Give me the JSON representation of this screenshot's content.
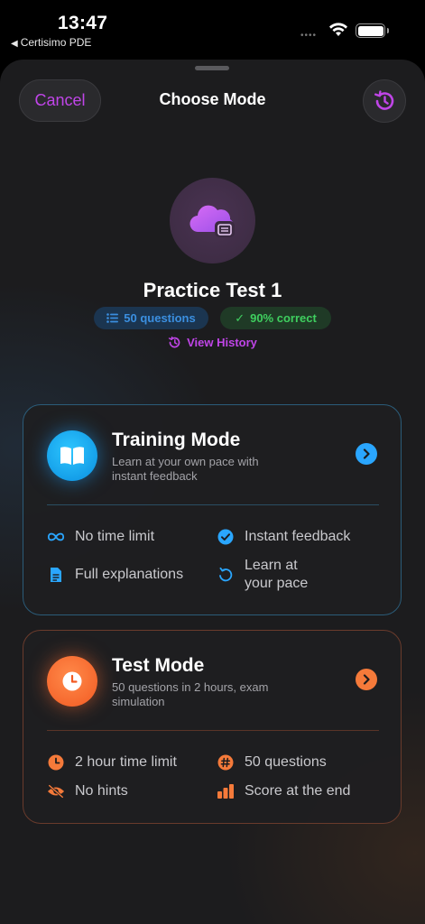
{
  "status_bar": {
    "time": "13:47",
    "back_app": "Certisimo PDE",
    "signal": "••••"
  },
  "header": {
    "cancel_label": "Cancel",
    "title": "Choose Mode"
  },
  "practice": {
    "title": "Practice Test 1",
    "questions_badge": "50 questions",
    "correct_badge": "90% correct",
    "view_history_label": "View History"
  },
  "training_mode": {
    "title": "Training Mode",
    "subtitle": "Learn at your own pace with instant feedback",
    "features": [
      {
        "icon": "infinity-icon",
        "label": "No time limit"
      },
      {
        "icon": "checkmark-circle-icon",
        "label": "Instant feedback"
      },
      {
        "icon": "document-icon",
        "label": "Full explanations"
      },
      {
        "icon": "refresh-icon",
        "label": "Learn at your pace"
      }
    ]
  },
  "test_mode": {
    "title": "Test Mode",
    "subtitle": "50 questions in 2 hours, exam simulation",
    "features": [
      {
        "icon": "clock-icon",
        "label": "2 hour time limit"
      },
      {
        "icon": "number-sign-icon",
        "label": "50 questions"
      },
      {
        "icon": "eye-slash-icon",
        "label": "No hints"
      },
      {
        "icon": "bar-chart-icon",
        "label": "Score at the end"
      }
    ]
  },
  "colors": {
    "accent_purple": "#c045e8",
    "training_blue": "#2aa6ff",
    "test_orange": "#f57a3a",
    "badge_blue": "#3b8fe0",
    "badge_green": "#3fcf5f"
  }
}
